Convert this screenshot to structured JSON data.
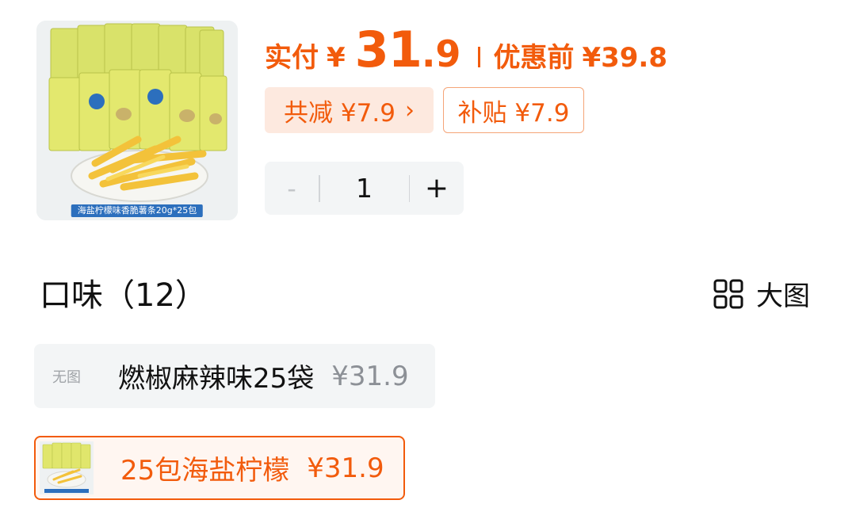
{
  "product": {
    "image_caption": "海盐柠檬味香脆薯条20g*25包"
  },
  "price": {
    "paid_label": "实付",
    "currency": "¥",
    "paid_int": "31",
    "paid_dec": ".9",
    "before_label": "优惠前",
    "before_price": "¥39.8"
  },
  "discounts": {
    "total_reduce": "共减 ¥7.9",
    "total_reduce_chevron": "›",
    "subsidy": "补贴 ¥7.9"
  },
  "quantity": {
    "minus": "-",
    "value": "1",
    "plus": "+"
  },
  "flavor": {
    "title": "口味（12）",
    "bigpic_label": "大图",
    "options": [
      {
        "no_image_label": "无图",
        "name": "燃椒麻辣味25袋",
        "price": "¥31.9",
        "selected": false
      },
      {
        "name": "25包海盐柠檬",
        "price": "¥31.9",
        "selected": true
      }
    ]
  },
  "colors": {
    "accent": "#f25b0c",
    "tag_bg": "#fde9df",
    "panel_bg": "#f3f5f6",
    "caption_bg": "#2c6fbd"
  },
  "icons": {
    "bigpic": "grid-icon"
  }
}
